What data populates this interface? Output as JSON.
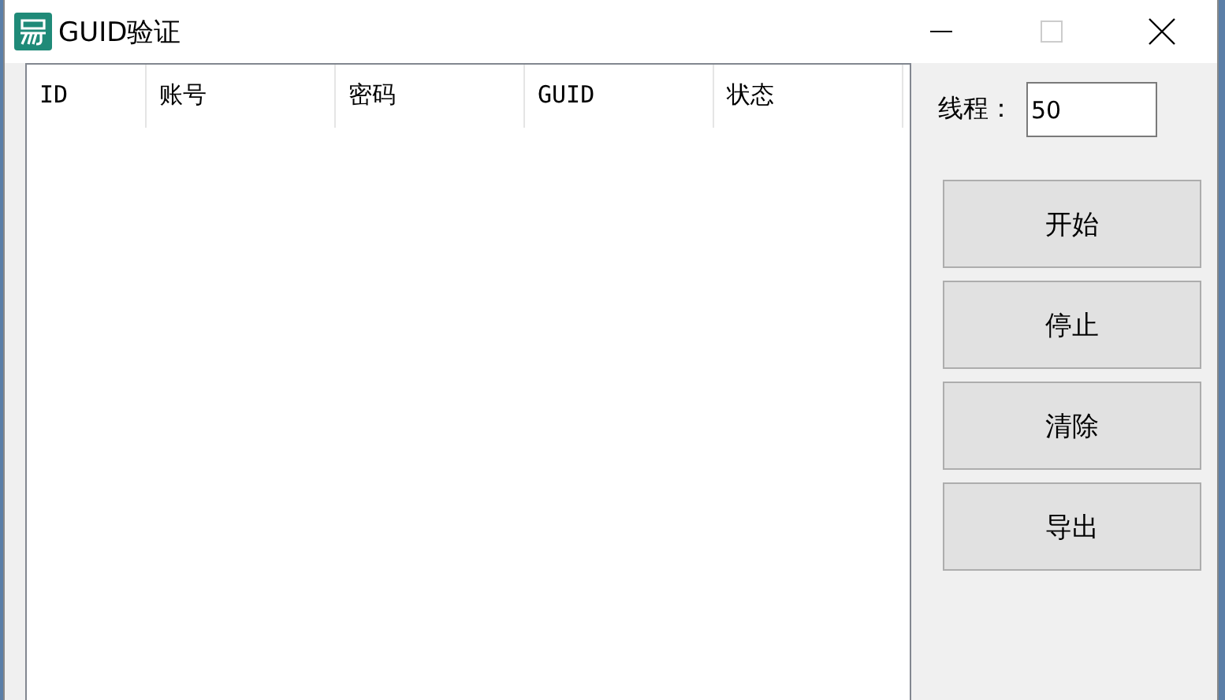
{
  "window": {
    "title": "GUID验证"
  },
  "list": {
    "columns": [
      "ID",
      "账号",
      "密码",
      "GUID",
      "状态"
    ]
  },
  "threads": {
    "label": "线程：",
    "value": "50"
  },
  "buttons": [
    "开始",
    "停止",
    "清除",
    "导出"
  ]
}
